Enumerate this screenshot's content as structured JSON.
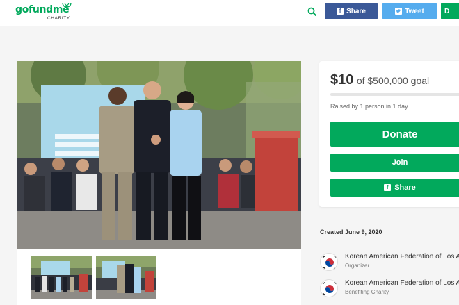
{
  "header": {
    "logo_main": "gofundme",
    "logo_sub": "CHARITY",
    "share_facebook_label": "Share",
    "tweet_label": "Tweet",
    "cta_partial_label": "D",
    "icons": {
      "search": "search-icon",
      "facebook": "facebook-icon",
      "twitter": "twitter-icon"
    },
    "colors": {
      "brand_green": "#02a95c",
      "facebook_blue": "#3b5998",
      "twitter_blue": "#55acee"
    }
  },
  "donation": {
    "amount": "$10",
    "goal_text": "of $500,000 goal",
    "progress_fraction": 2e-05,
    "raised_by": "Raised by 1 person in 1 day",
    "donate_label": "Donate",
    "join_label": "Join",
    "share_label": "Share"
  },
  "campaign": {
    "created": "Created June 9, 2020",
    "organizers": [
      {
        "name": "Korean American Federation of Los An",
        "role": "Organizer",
        "icon": "korean-flag-avatar"
      },
      {
        "name": "Korean American Federation of Los An",
        "role": "Benefiting Charity",
        "icon": "korean-flag-avatar"
      }
    ]
  },
  "media": {
    "main_photo": "three-people-joining-hands-ceremony-photo",
    "thumbnails": [
      "group-ceremony-thumbnail",
      "handshake-thumbnail"
    ]
  }
}
